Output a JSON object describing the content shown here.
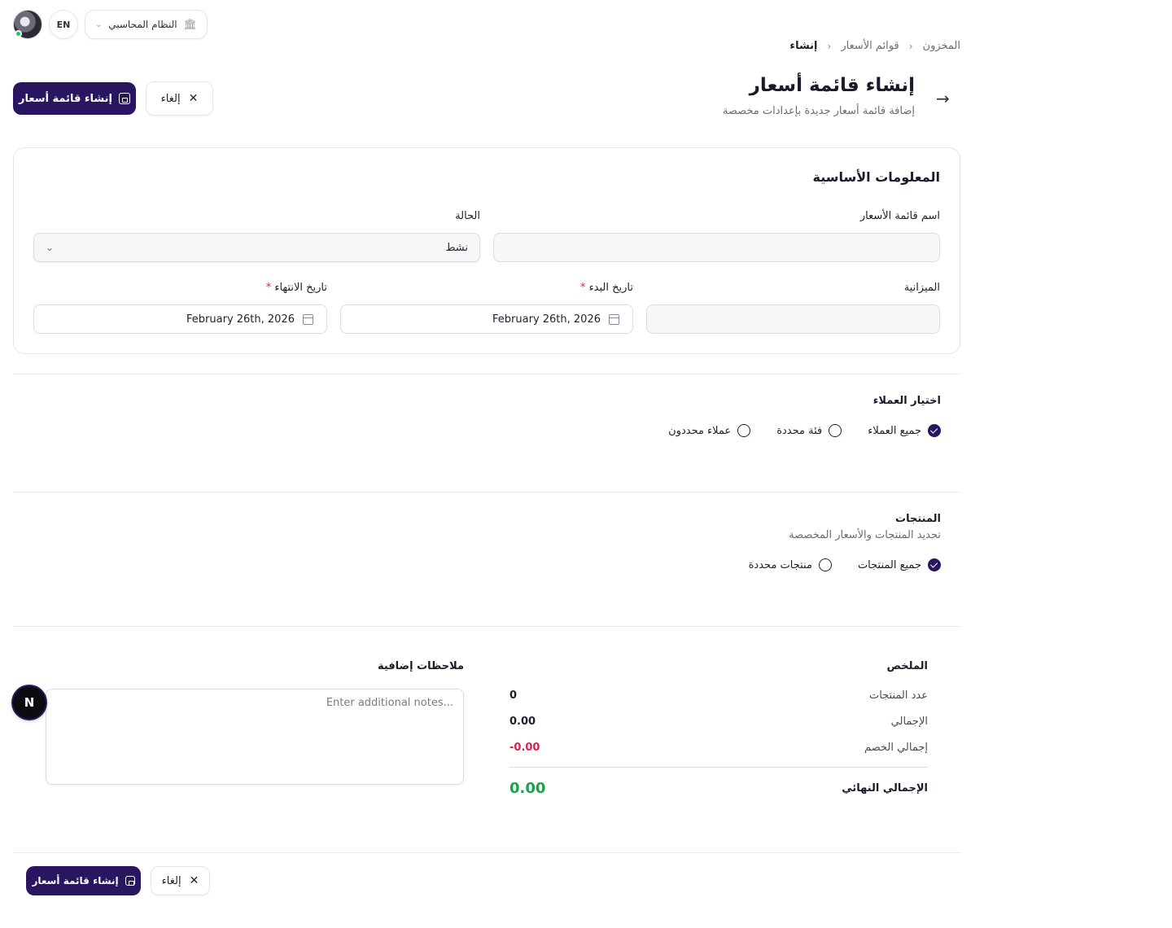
{
  "topbar": {
    "lang_label": "EN",
    "system_label": "النظام المحاسبي"
  },
  "breadcrumb": {
    "items": [
      "المخزون",
      "قوائم الأسعار",
      "إنشاء"
    ]
  },
  "header": {
    "title": "إنشاء قائمة أسعار",
    "subtitle": "إضافة قائمة أسعار جديدة بإعدادات مخصصة",
    "create_label": "إنشاء قائمة أسعار",
    "cancel_label": "إلغاء"
  },
  "basic_info": {
    "title": "المعلومات الأساسية",
    "name_label": "اسم قائمة الأسعار",
    "name_value": "",
    "status_label": "الحالة",
    "status_value": "نشط",
    "budget_label": "الميزانية",
    "budget_value": "",
    "start_label": "تاريخ البدء",
    "start_value": "February 26th, 2026",
    "end_label": "تاريخ الانتهاء",
    "end_value": "February 26th, 2026",
    "required_mark": "*"
  },
  "customers": {
    "title": "اختيار العملاء",
    "options": [
      {
        "label": "جميع العملاء",
        "checked": true
      },
      {
        "label": "فئة محددة",
        "checked": false
      },
      {
        "label": "عملاء محددون",
        "checked": false
      }
    ]
  },
  "products": {
    "title": "المنتجات",
    "subtitle": "تحديد المنتجات والأسعار المخصصة",
    "options": [
      {
        "label": "جميع المنتجات",
        "checked": true
      },
      {
        "label": "منتجات محددة",
        "checked": false
      }
    ]
  },
  "summary": {
    "title": "الملخص",
    "products_count_label": "عدد المنتجات",
    "products_count_value": "0",
    "total_label": "الإجمالي",
    "total_value": "0.00",
    "discount_label": "إجمالي الخصم",
    "discount_value": "-0.00",
    "final_label": "الإجمالي النهائي",
    "final_value": "0.00"
  },
  "notes": {
    "title": "ملاحظات إضافية",
    "placeholder": "...Enter additional notes",
    "value": ""
  },
  "footer": {
    "create_label": "إنشاء قائمة أسعار",
    "cancel_label": "إلغاء"
  },
  "badge": {
    "letter": "N"
  },
  "colors": {
    "primary": "#2a1660",
    "discount": "#e11d48",
    "final_total": "#16a34a",
    "online_dot": "#22c55e"
  }
}
